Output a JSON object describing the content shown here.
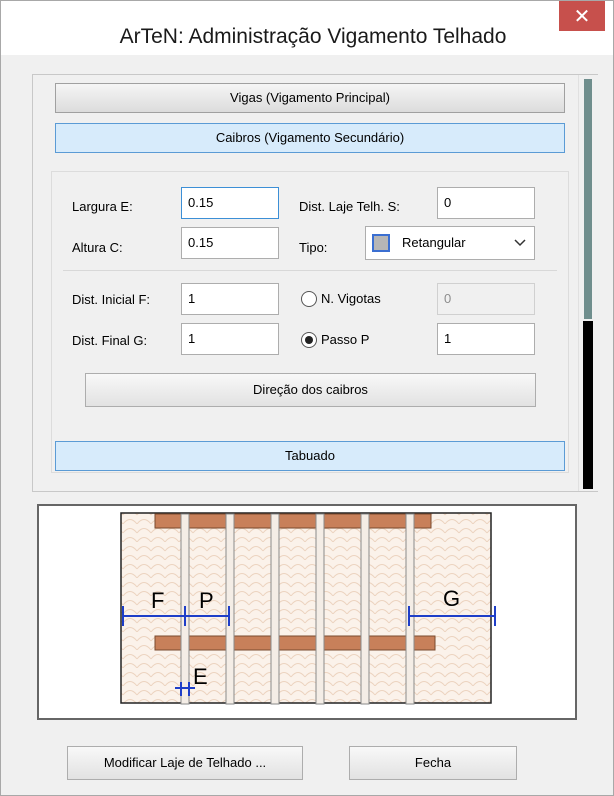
{
  "window": {
    "title": "ArTeN: Administração Vigamento Telhado",
    "close_glyph": "✕"
  },
  "sections": {
    "vigas_label": "Vigas (Vigamento Principal)",
    "caibros_label": "Caibros (Vigamento Secundário)",
    "tabuado_label": "Tabuado"
  },
  "form": {
    "largura_label": "Largura E:",
    "largura_value": "0.15",
    "altura_label": "Altura C:",
    "altura_value": "0.15",
    "dist_laje_label": "Dist. Laje Telh. S:",
    "dist_laje_value": "0",
    "tipo_label": "Tipo:",
    "tipo_value": "Retangular",
    "dist_inicial_label": "Dist. Inicial F:",
    "dist_inicial_value": "1",
    "dist_final_label": "Dist. Final G:",
    "dist_final_value": "1",
    "n_vigotas_label": "N. Vigotas",
    "n_vigotas_value": "0",
    "passo_label": "Passo P",
    "passo_value": "1",
    "direcao_label": "Direção dos caibros"
  },
  "diagram": {
    "label_f": "F",
    "label_p": "P",
    "label_g": "G",
    "label_e": "E"
  },
  "footer": {
    "modificar_label": "Modificar Laje de Telhado ...",
    "fecha_label": "Fecha"
  },
  "colors": {
    "accent_blue": "#5b9bd5",
    "band_blue_bg": "#d7ebfb",
    "beam_brown": "#c8805a",
    "dimension_blue": "#1e3ec8"
  }
}
